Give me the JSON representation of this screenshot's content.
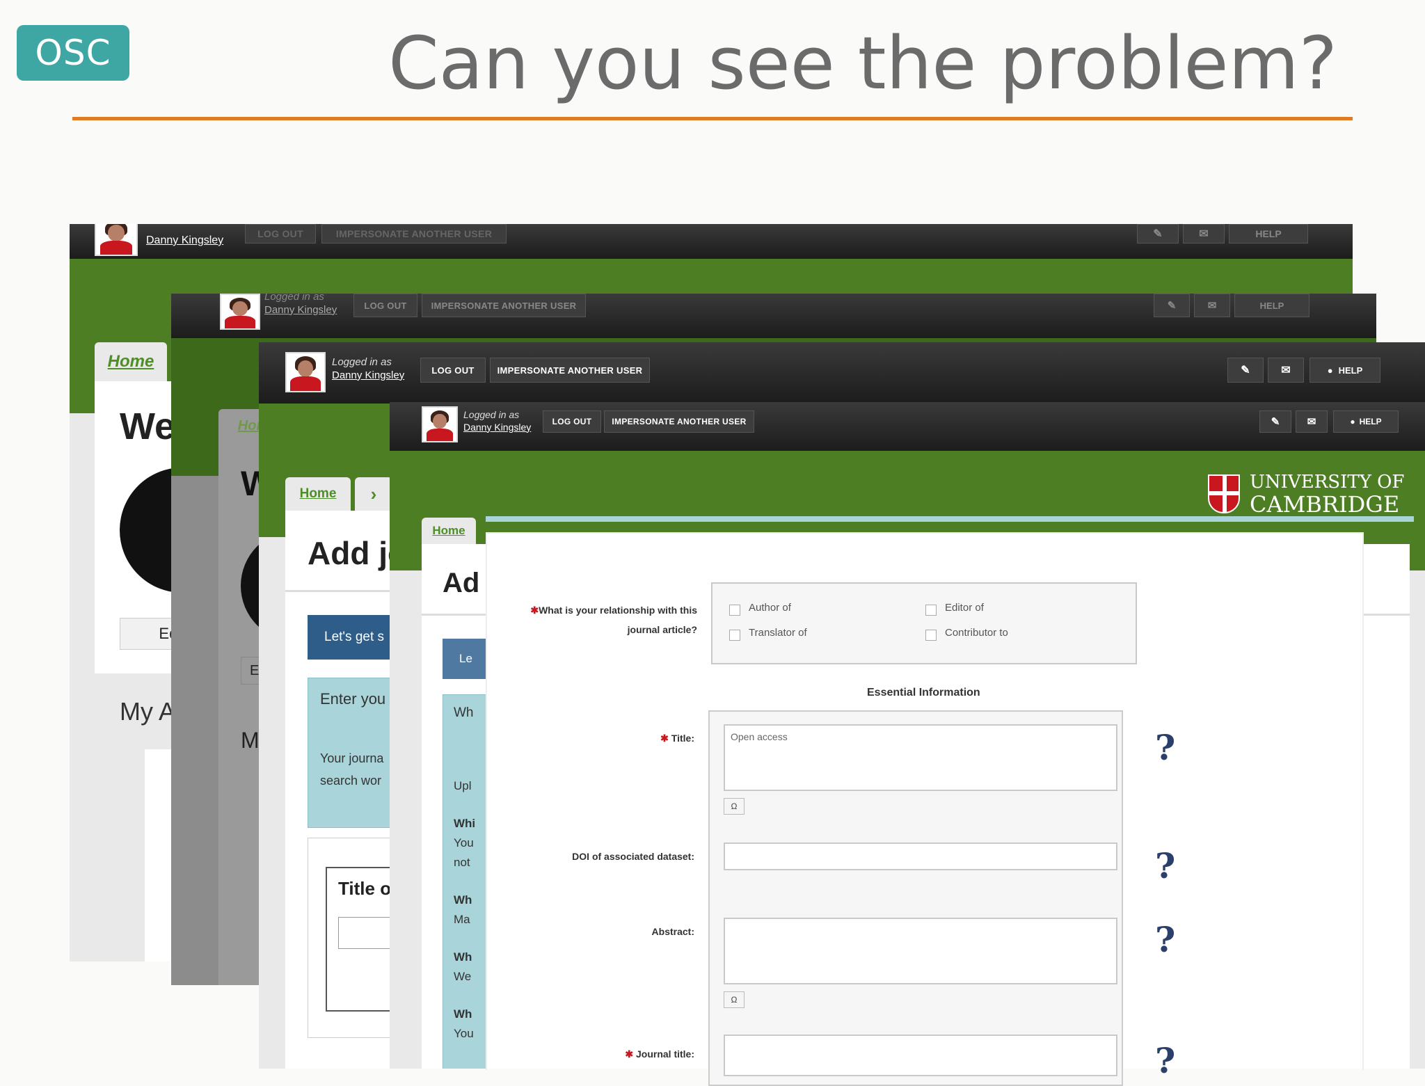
{
  "slide": {
    "badge": "OSC",
    "title": "Can you see the problem?",
    "accent_color": "#e07a23",
    "badge_color": "#3fa7a3"
  },
  "colors": {
    "topbar": "#1c1c1c",
    "green": "#4e7e24",
    "link_green": "#4e8e27",
    "button_blue": "#2f5d89",
    "required_red": "#c8171e"
  },
  "user_bar": {
    "logged_in_as": "Logged in as",
    "user_name": "Danny Kingsley",
    "logout": "LOG OUT",
    "impersonate": "IMPERSONATE ANOTHER USER",
    "help": "HELP",
    "icons": [
      "pin-icon",
      "envelope-icon",
      "chat-help-icon"
    ]
  },
  "nav": {
    "home": "Home",
    "chevron": "›"
  },
  "layer1": {
    "heading": "We",
    "edit_button": "Edit yo",
    "section": "My A"
  },
  "layer2": {
    "tab": "Hom",
    "heading": "W",
    "edit_button": "E",
    "section": "M"
  },
  "layer3": {
    "heading": "Add jo",
    "start_button": "Let's get s",
    "enter_text": "Enter you",
    "journal_text_1": "Your journa",
    "journal_text_2": "search wor",
    "title_field": "Title o"
  },
  "layer4": {
    "heading": "Ad",
    "start_button": "Le",
    "lines": [
      "Wh",
      "Upl",
      "Whi",
      "You",
      "not",
      "Wh",
      "Ma",
      "Wh",
      "We",
      "Wh",
      "You"
    ]
  },
  "institution": {
    "line1": "UNIVERSITY OF",
    "line2": "CAMBRIDGE"
  },
  "form": {
    "relationship_label_1": "What is your relationship with this",
    "relationship_label_2": "journal article?",
    "relationship_options": [
      "Author of",
      "Editor of",
      "Translator of",
      "Contributor to"
    ],
    "section_heading": "Essential Information",
    "title_label": "Title:",
    "title_value": "Open access",
    "doi_label": "DOI of associated dataset:",
    "abstract_label": "Abstract:",
    "journal_title_label": "Journal title:",
    "omega": "Ω",
    "help_mark": "?"
  }
}
